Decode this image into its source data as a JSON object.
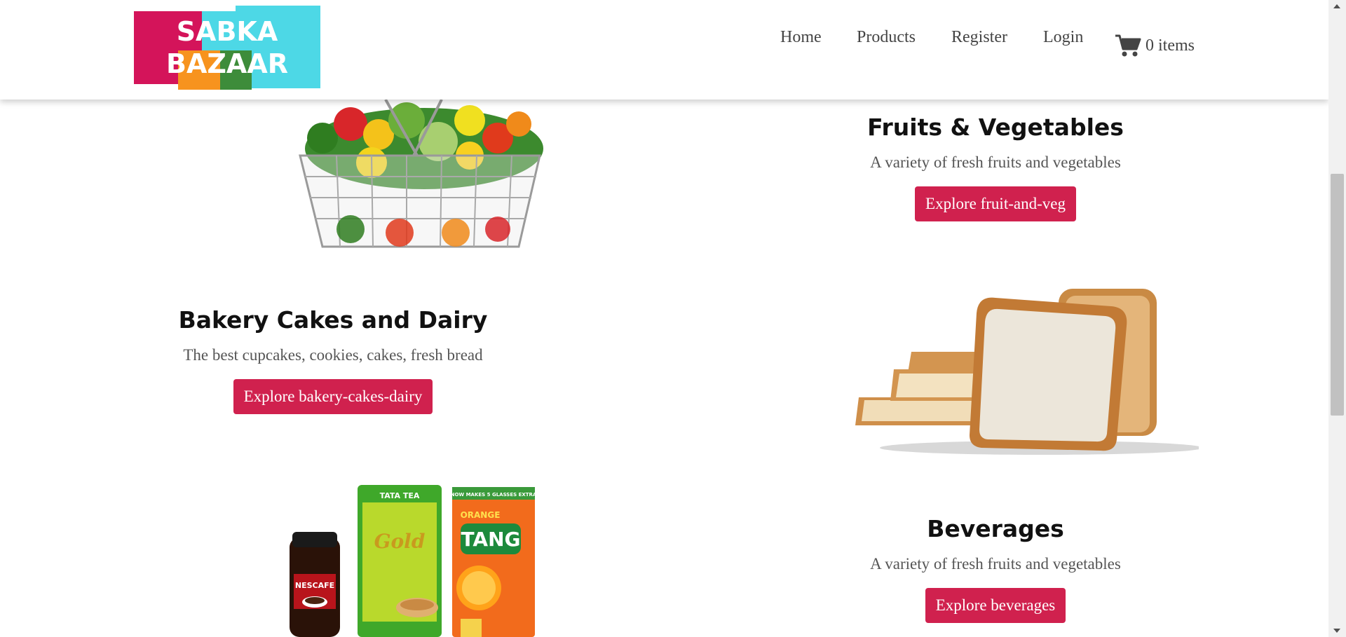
{
  "logo": {
    "line1": "SABKA",
    "line2": "BAZAAR",
    "colors": [
      "#d4145a",
      "#f7931e",
      "#39b54a",
      "#29abe2"
    ]
  },
  "nav": {
    "home": "Home",
    "products": "Products",
    "register": "Register",
    "login": "Login",
    "cart_icon": "shopping-cart-icon",
    "cart_label": "0 items"
  },
  "categories": [
    {
      "title": "Fruits & Vegetables",
      "description": "A variety of fresh fruits and vegetables",
      "button": "Explore fruit-and-veg",
      "image": "fruit-basket"
    },
    {
      "title": "Bakery Cakes and Dairy",
      "description": "The best cupcakes, cookies, cakes, fresh bread",
      "button": "Explore bakery-cakes-dairy",
      "image": "bread-slices"
    },
    {
      "title": "Beverages",
      "description": "A variety of fresh fruits and vegetables",
      "button": "Explore beverages",
      "image": "beverage-packs"
    }
  ],
  "product_text": {
    "nescafe": "NESCAFE",
    "tata": "TATA TEA",
    "gold": "Gold",
    "tang": "TANG",
    "orange": "ORANGE",
    "extra": "NOW MAKES 5 GLASSES EXTRA"
  },
  "colors": {
    "accent": "#d0214e",
    "title": "#111111",
    "text": "#555555"
  }
}
